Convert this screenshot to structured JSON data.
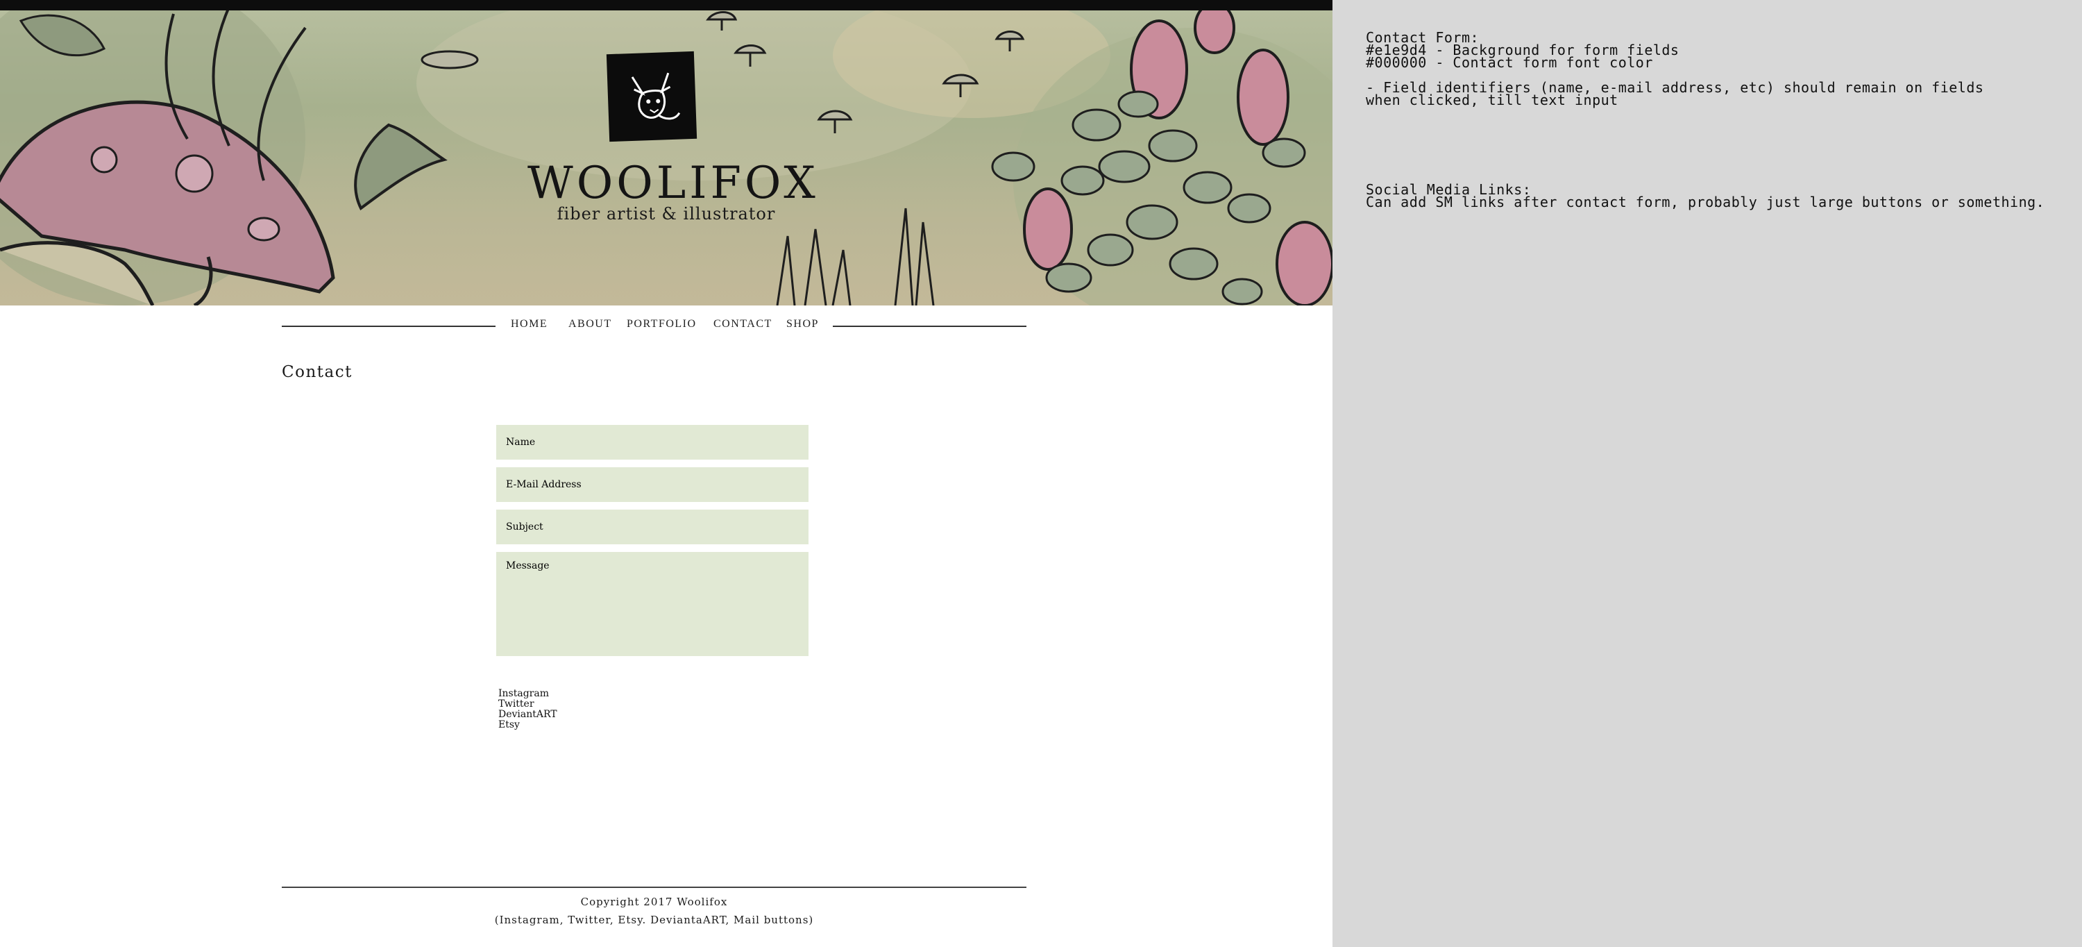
{
  "header": {
    "brand_name": "WOOLIFOX",
    "tagline": "fiber artist & illustrator",
    "logo_icon": "fox-logo-icon"
  },
  "nav": {
    "items": [
      {
        "label": "HOME"
      },
      {
        "label": "ABOUT"
      },
      {
        "label": "PORTFOLIO"
      },
      {
        "label": "CONTACT"
      },
      {
        "label": "SHOP"
      }
    ]
  },
  "main": {
    "page_title": "Contact",
    "form": {
      "name_placeholder": "Name",
      "email_placeholder": "E-Mail Address",
      "subject_placeholder": "Subject",
      "message_placeholder": "Message",
      "field_bg": "#e1e9d4",
      "font_color": "#000000"
    },
    "social_links": [
      "Instagram",
      "Twitter",
      "DeviantART",
      "Etsy"
    ]
  },
  "footer": {
    "copyright": "Copyright 2017 Woolifox",
    "note": "(Instagram, Twitter, Etsy. DeviantaART, Mail buttons)"
  },
  "notes": {
    "lines": [
      "Contact Form:",
      "#e1e9d4 - Background for form fields",
      "#000000 - Contact form font color",
      "- Field identifiers (name, e-mail address, etc) should remain on fields",
      "when clicked, till text input",
      "Social Media Links:",
      "Can add SM links after contact form, probably just large buttons or something."
    ],
    "panel_bg": "#d8d8d8"
  }
}
